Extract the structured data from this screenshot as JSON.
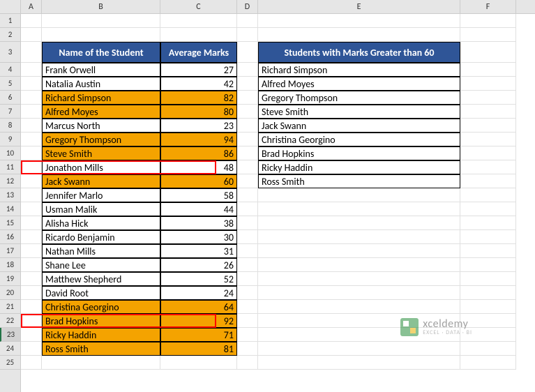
{
  "columns": [
    "A",
    "B",
    "C",
    "D",
    "E",
    "F"
  ],
  "row_numbers": [
    1,
    2,
    3,
    4,
    5,
    6,
    7,
    8,
    9,
    10,
    11,
    12,
    13,
    14,
    15,
    16,
    17,
    18,
    19,
    20,
    21,
    22,
    23,
    24,
    25
  ],
  "selected_row": 23,
  "tall_rows": [
    3
  ],
  "table1": {
    "header_b": "Name of the Student",
    "header_c": "Average Marks",
    "rows": [
      {
        "name": "Frank Orwell",
        "marks": 27,
        "hl": false
      },
      {
        "name": "Natalia Austin",
        "marks": 42,
        "hl": false
      },
      {
        "name": "Richard Simpson",
        "marks": 82,
        "hl": true
      },
      {
        "name": "Alfred Moyes",
        "marks": 80,
        "hl": true
      },
      {
        "name": "Marcus North",
        "marks": 23,
        "hl": false
      },
      {
        "name": "Gregory Thompson",
        "marks": 94,
        "hl": true
      },
      {
        "name": "Steve Smith",
        "marks": 86,
        "hl": true
      },
      {
        "name": "Jonathon Mills",
        "marks": 48,
        "hl": false
      },
      {
        "name": "Jack Swann",
        "marks": 60,
        "hl": true
      },
      {
        "name": "Jennifer Marlo",
        "marks": 58,
        "hl": false
      },
      {
        "name": "Usman Malik",
        "marks": 44,
        "hl": false
      },
      {
        "name": "Alisha Hick",
        "marks": 38,
        "hl": false
      },
      {
        "name": "Ricardo Benjamin",
        "marks": 30,
        "hl": false
      },
      {
        "name": "Nathan Mills",
        "marks": 31,
        "hl": false
      },
      {
        "name": "Shane Lee",
        "marks": 26,
        "hl": false
      },
      {
        "name": "Matthew Shepherd",
        "marks": 52,
        "hl": false
      },
      {
        "name": "David Root",
        "marks": 24,
        "hl": false
      },
      {
        "name": "Christina Georgino",
        "marks": 64,
        "hl": true
      },
      {
        "name": "Brad Hopkins",
        "marks": 92,
        "hl": true
      },
      {
        "name": "Ricky Haddin",
        "marks": 71,
        "hl": true
      },
      {
        "name": "Ross Smith",
        "marks": 81,
        "hl": true
      }
    ]
  },
  "table2": {
    "header": "Students with Marks Greater than 60",
    "rows": [
      "Richard Simpson",
      "Alfred Moyes",
      "Gregory Thompson",
      "Steve Smith",
      "Jack Swann",
      "Christina Georgino",
      "Brad Hopkins",
      "Ricky Haddin",
      "Ross Smith"
    ]
  },
  "watermark": {
    "name": "xceldemy",
    "tag": "EXCEL · DATA · BI"
  }
}
